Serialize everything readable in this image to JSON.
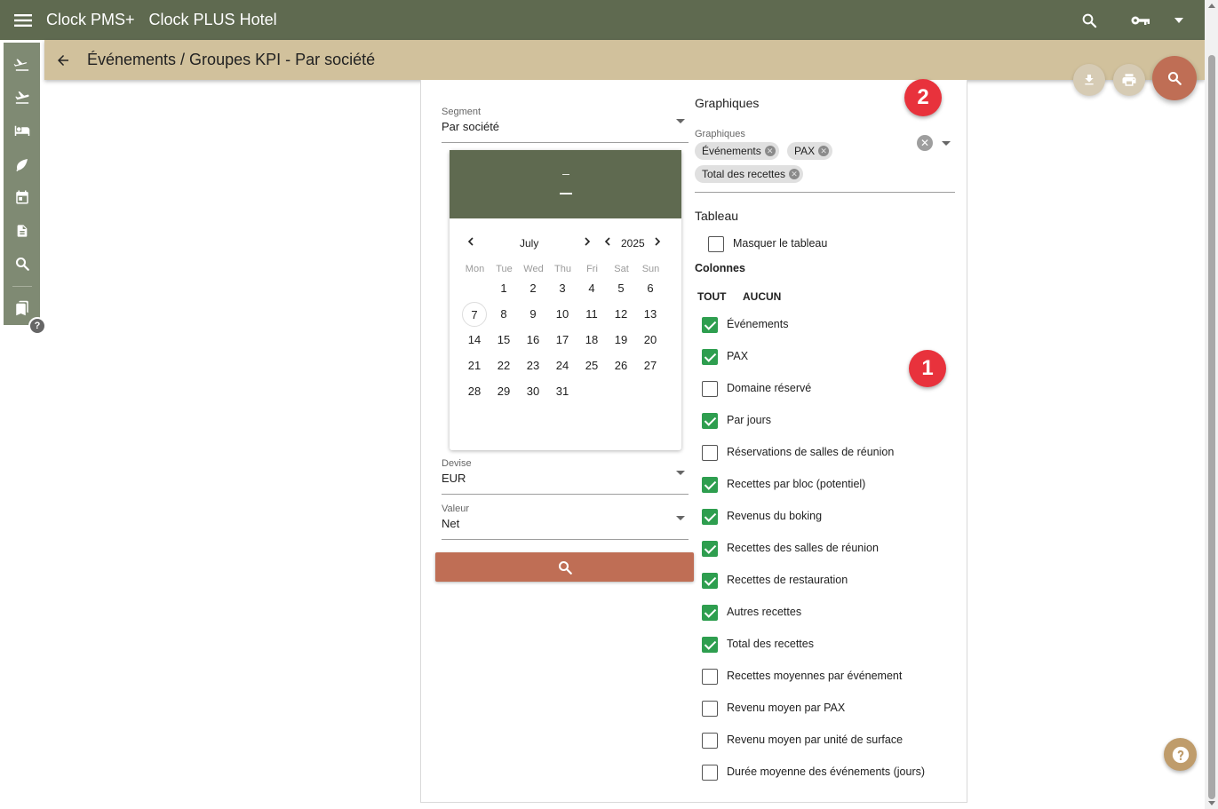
{
  "app": {
    "brand": "Clock PMS+",
    "hotel": "Clock PLUS Hotel"
  },
  "header": {
    "title": "Événements / Groupes KPI - Par société"
  },
  "filters": {
    "segment": {
      "label": "Segment",
      "value": "Par société"
    },
    "currency": {
      "label": "Devise",
      "value": "EUR"
    },
    "valeur": {
      "label": "Valeur",
      "value": "Net"
    }
  },
  "calendar": {
    "month": "July",
    "year": "2025",
    "weekdays": [
      "Mon",
      "Tue",
      "Wed",
      "Thu",
      "Fri",
      "Sat",
      "Sun"
    ],
    "today": "7",
    "weeks": [
      [
        "",
        "1",
        "2",
        "3",
        "4",
        "5",
        "6"
      ],
      [
        "7",
        "8",
        "9",
        "10",
        "11",
        "12",
        "13"
      ],
      [
        "14",
        "15",
        "16",
        "17",
        "18",
        "19",
        "20"
      ],
      [
        "21",
        "22",
        "23",
        "24",
        "25",
        "26",
        "27"
      ],
      [
        "28",
        "29",
        "30",
        "31",
        "",
        "",
        ""
      ]
    ]
  },
  "charts": {
    "section_title": "Graphiques",
    "field_label": "Graphiques",
    "chips": [
      "Événements",
      "PAX",
      "Total des recettes"
    ]
  },
  "table": {
    "section_title": "Tableau",
    "hide_table": {
      "label": "Masquer le tableau",
      "checked": false
    },
    "columns_title": "Colonnes",
    "select_all": "TOUT",
    "select_none": "AUCUN",
    "columns": [
      {
        "label": "Événements",
        "checked": true
      },
      {
        "label": "PAX",
        "checked": true
      },
      {
        "label": "Domaine réservé",
        "checked": false
      },
      {
        "label": "Par jours",
        "checked": true
      },
      {
        "label": "Réservations de salles de réunion",
        "checked": false
      },
      {
        "label": "Recettes par bloc (potentiel)",
        "checked": true
      },
      {
        "label": "Revenus du boking",
        "checked": true
      },
      {
        "label": "Recettes des salles de réunion",
        "checked": true
      },
      {
        "label": "Recettes de restauration",
        "checked": true
      },
      {
        "label": "Autres recettes",
        "checked": true
      },
      {
        "label": "Total des recettes",
        "checked": true
      },
      {
        "label": "Recettes moyennes par événement",
        "checked": false
      },
      {
        "label": "Revenu moyen par PAX",
        "checked": false
      },
      {
        "label": "Revenu moyen par unité de surface",
        "checked": false
      },
      {
        "label": "Durée moyenne des événements (jours)",
        "checked": false
      }
    ]
  },
  "badges": [
    "1",
    "2"
  ],
  "colors": {
    "topbar": "#5f6a50",
    "subbar": "#d1c19c",
    "accent": "#bf6e55",
    "check": "#2e9e4f",
    "badge": "#e8323c"
  }
}
